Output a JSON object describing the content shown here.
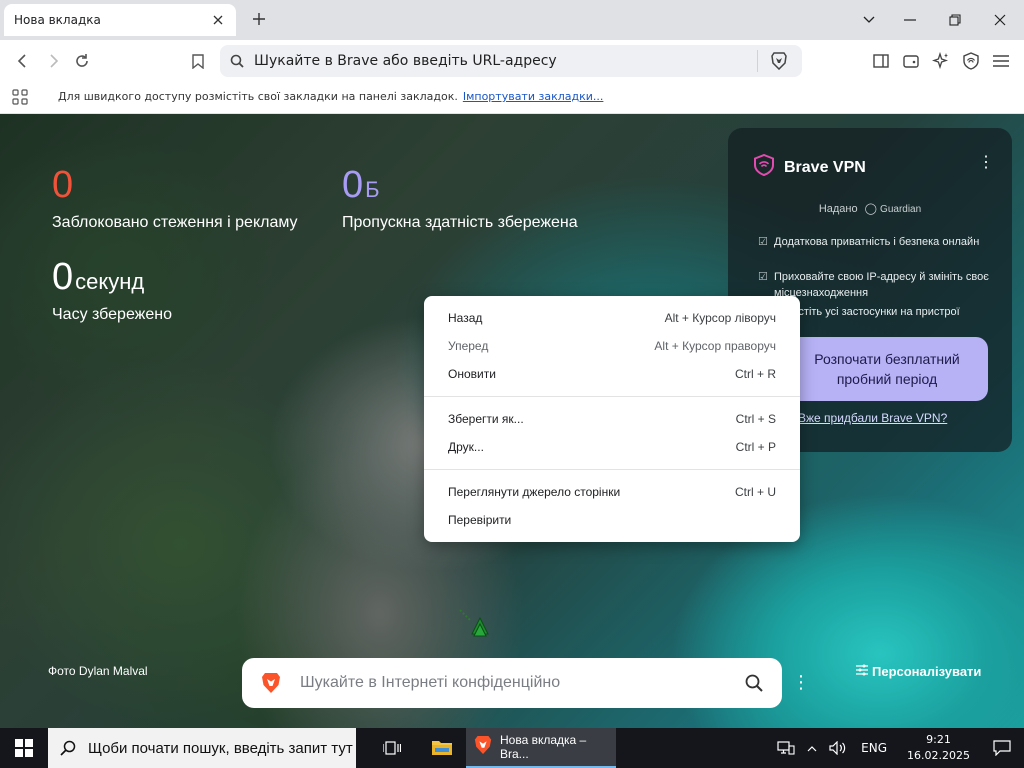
{
  "browser": {
    "tab_title": "Нова вкладка",
    "url_placeholder": "Шукайте в Brave або введіть URL-адресу"
  },
  "bookmarks": {
    "hint": "Для швидкого доступу розмістіть свої закладки на панелі закладок.",
    "import_link": "Імпортувати закладки..."
  },
  "stats": {
    "blocked_value": "0",
    "blocked_label": "Заблоковано стеження і рекламу",
    "bandwidth_value": "0",
    "bandwidth_unit": "Б",
    "bandwidth_label": "Пропускна здатність збережена",
    "time_value": "0",
    "time_unit": "секунд",
    "time_label": "Часу збережено"
  },
  "vpn": {
    "title": "Brave VPN",
    "powered_by": "Надано",
    "partner": "Guardian",
    "features": [
      "Додаткова приватність і безпека онлайн",
      "Приховайте свою IP-адресу й змініть своє місцезнаходження",
      "Захистіть усі застосунки на пристрої"
    ],
    "cta": "Розпочати безплатний пробний період",
    "link": "Вже придбали Brave VPN?"
  },
  "context_menu": {
    "items": [
      {
        "label": "Назад",
        "shortcut": "Alt + Курсор ліворуч",
        "disabled": false
      },
      {
        "label": "Уперед",
        "shortcut": "Alt + Курсор праворуч",
        "disabled": true
      },
      {
        "label": "Оновити",
        "shortcut": "Ctrl + R",
        "disabled": false
      },
      {
        "label": "Зберегти як...",
        "shortcut": "Ctrl + S",
        "disabled": false
      },
      {
        "label": "Друк...",
        "shortcut": "Ctrl + P",
        "disabled": false
      },
      {
        "label": "Переглянути джерело сторінки",
        "shortcut": "Ctrl + U",
        "disabled": false
      },
      {
        "label": "Перевірити",
        "shortcut": "",
        "disabled": false
      }
    ]
  },
  "page": {
    "photo_credit": "Фото Dylan Malval",
    "search_placeholder": "Шукайте в Інтернеті конфіденційно",
    "customize": "Персоналізувати"
  },
  "taskbar": {
    "search_placeholder": "Щоби почати пошук, введіть запит тут",
    "active_app": "Нова вкладка – Bra...",
    "language": "ENG",
    "time": "9:21",
    "date": "16.02.2025"
  },
  "colors": {
    "blocked_accent": "#f0533a",
    "bandwidth_accent": "#a99cf5",
    "vpn_cta": "#b7b2f6"
  }
}
